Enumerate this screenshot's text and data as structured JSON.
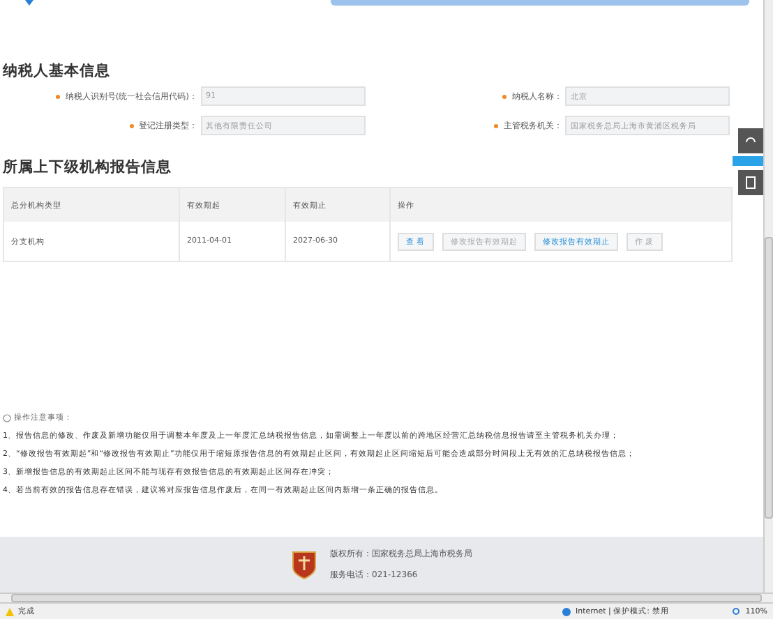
{
  "basic_info": {
    "title": "纳税人基本信息",
    "fields": [
      {
        "label": "纳税人识别号(统一社会信用代码)：",
        "value": "91"
      },
      {
        "label": "纳税人名称：",
        "value": "北京"
      },
      {
        "label": "登记注册类型：",
        "value": "其他有限责任公司"
      },
      {
        "label": "主管税务机关：",
        "value": "国家税务总局上海市黄浦区税务局"
      }
    ]
  },
  "reports": {
    "title": "所属上下级机构报告信息",
    "columns": [
      "总分机构类型",
      "有效期起",
      "有效期止",
      "操作"
    ],
    "rows": [
      {
        "cells": [
          "分支机构",
          "2011-04-01",
          "2027-06-30"
        ],
        "actions": [
          {
            "label": "查 看",
            "disabled": false
          },
          {
            "label": "修改报告有效期起",
            "disabled": true
          },
          {
            "label": "修改报告有效期止",
            "disabled": false
          },
          {
            "label": "作 废",
            "disabled": true
          }
        ]
      }
    ]
  },
  "notes": {
    "title": "操作注意事项：",
    "items": [
      "1、报告信息的修改、作废及新增功能仅用于调整本年度及上一年度汇总纳税报告信息，如需调整上一年度以前的跨地区经营汇总纳税信息报告请至主管税务机关办理；",
      "2、“修改报告有效期起”和“修改报告有效期止”功能仅用于缩短原报告信息的有效期起止区间，有效期起止区间缩短后可能会造成部分时间段上无有效的汇总纳税报告信息；",
      "3、新增报告信息的有效期起止区间不能与现存有效报告信息的有效期起止区间存在冲突；",
      "4、若当前有效的报告信息存在错误，建议将对应报告信息作废后，在同一有效期起止区间内新增一条正确的报告信息。"
    ]
  },
  "footer": {
    "copyright": "版权所有：国家税务总局上海市税务局",
    "phone": "服务电话：021-12366"
  },
  "status_bar": {
    "status": "完成",
    "zone": "Internet | 保护模式: 禁用",
    "zoom": "110%"
  }
}
